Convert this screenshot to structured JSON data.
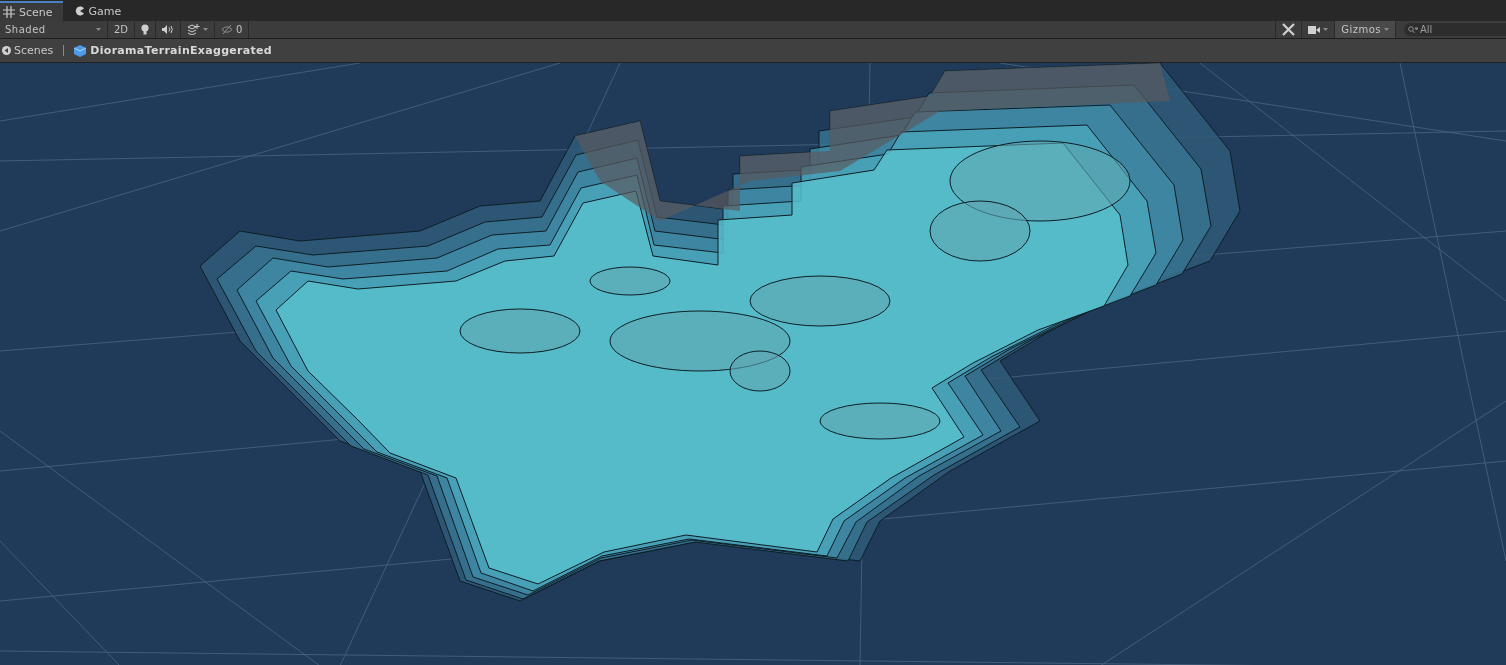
{
  "tabs": [
    {
      "label": "Scene",
      "selected": true
    },
    {
      "label": "Game",
      "selected": false
    }
  ],
  "toolbar": {
    "shading_mode": "Shaded",
    "toggle_2d": "2D",
    "toggle_2d_on": false,
    "lighting_on": false,
    "audio_on": false,
    "effects_on": false,
    "hidden_count": "0",
    "gizmos": "Gizmos",
    "search": {
      "placeholder": "All"
    }
  },
  "breadcrumb": {
    "root": "Scenes",
    "scene": "DioramaTerrainExaggerated"
  }
}
